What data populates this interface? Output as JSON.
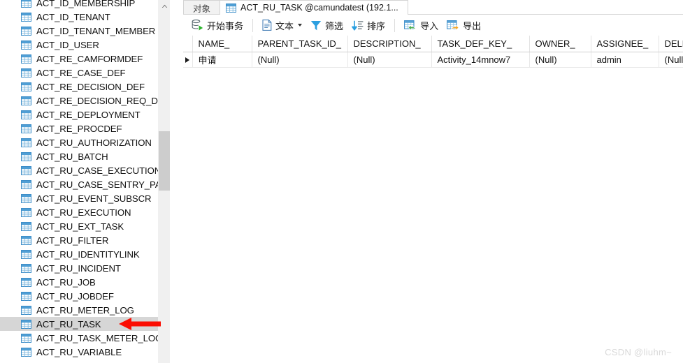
{
  "sidebar": {
    "name": "database-table-list",
    "items": [
      {
        "label": "ACT_ID_MEMBERSHIP",
        "selected": false
      },
      {
        "label": "ACT_ID_TENANT",
        "selected": false
      },
      {
        "label": "ACT_ID_TENANT_MEMBER",
        "selected": false
      },
      {
        "label": "ACT_ID_USER",
        "selected": false
      },
      {
        "label": "ACT_RE_CAMFORMDEF",
        "selected": false
      },
      {
        "label": "ACT_RE_CASE_DEF",
        "selected": false
      },
      {
        "label": "ACT_RE_DECISION_DEF",
        "selected": false
      },
      {
        "label": "ACT_RE_DECISION_REQ_DEF",
        "selected": false
      },
      {
        "label": "ACT_RE_DEPLOYMENT",
        "selected": false
      },
      {
        "label": "ACT_RE_PROCDEF",
        "selected": false
      },
      {
        "label": "ACT_RU_AUTHORIZATION",
        "selected": false
      },
      {
        "label": "ACT_RU_BATCH",
        "selected": false
      },
      {
        "label": "ACT_RU_CASE_EXECUTION",
        "selected": false
      },
      {
        "label": "ACT_RU_CASE_SENTRY_PART",
        "selected": false
      },
      {
        "label": "ACT_RU_EVENT_SUBSCR",
        "selected": false
      },
      {
        "label": "ACT_RU_EXECUTION",
        "selected": false
      },
      {
        "label": "ACT_RU_EXT_TASK",
        "selected": false
      },
      {
        "label": "ACT_RU_FILTER",
        "selected": false
      },
      {
        "label": "ACT_RU_IDENTITYLINK",
        "selected": false
      },
      {
        "label": "ACT_RU_INCIDENT",
        "selected": false
      },
      {
        "label": "ACT_RU_JOB",
        "selected": false
      },
      {
        "label": "ACT_RU_JOBDEF",
        "selected": false
      },
      {
        "label": "ACT_RU_METER_LOG",
        "selected": false
      },
      {
        "label": "ACT_RU_TASK",
        "selected": true
      },
      {
        "label": "ACT_RU_TASK_METER_LOG",
        "selected": false
      },
      {
        "label": "ACT_RU_VARIABLE",
        "selected": false
      }
    ]
  },
  "tabs": [
    {
      "label": "对象",
      "active": false,
      "icon": "none"
    },
    {
      "label": "ACT_RU_TASK @camundatest (192.1...",
      "active": true,
      "icon": "table-icon"
    }
  ],
  "toolbar": {
    "items": [
      {
        "label": "开始事务",
        "icon": "begin-transaction-icon",
        "caret": false
      },
      {
        "sep": true
      },
      {
        "label": "文本",
        "icon": "text-icon",
        "caret": true
      },
      {
        "label": "筛选",
        "icon": "filter-icon",
        "caret": false
      },
      {
        "label": "排序",
        "icon": "sort-icon",
        "caret": false
      },
      {
        "sep": true
      },
      {
        "label": "导入",
        "icon": "import-icon",
        "caret": false
      },
      {
        "label": "导出",
        "icon": "export-icon",
        "caret": false
      }
    ]
  },
  "grid": {
    "columns": [
      "NAME_",
      "PARENT_TASK_ID_",
      "DESCRIPTION_",
      "TASK_DEF_KEY_",
      "OWNER_",
      "ASSIGNEE_",
      "DELEGATION_"
    ],
    "rows": [
      {
        "marker": "current-row",
        "cells": [
          "申请",
          "(Null)",
          "(Null)",
          "Activity_14mnow7",
          "(Null)",
          "admin",
          "(Null)"
        ]
      }
    ],
    "null_text": "(Null)"
  },
  "annotations": [
    {
      "name": "red-arrow-grid",
      "color": "#fb0d02",
      "direction": "up-left"
    },
    {
      "name": "red-arrow-sidebar",
      "color": "#fb0d02",
      "direction": "left"
    }
  ],
  "watermark": {
    "text": "CSDN @liuhm~"
  },
  "colors": {
    "selection": "#d6d6d6",
    "table_icon": "#3d8ec9",
    "annotation": "#fb0d02",
    "null_text": "#b9b9bf"
  }
}
